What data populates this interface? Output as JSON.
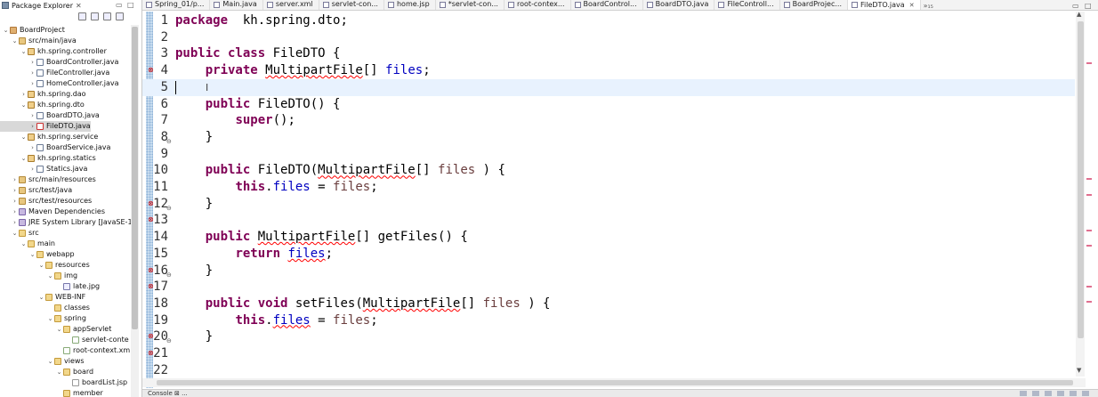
{
  "package_explorer": {
    "title": "Package Explorer",
    "tree": [
      {
        "label": "BoardProject",
        "depth": 0,
        "icon": "project",
        "twisty": "open"
      },
      {
        "label": "src/main/java",
        "depth": 1,
        "icon": "srcfolder",
        "twisty": "open"
      },
      {
        "label": "kh.spring.controller",
        "depth": 2,
        "icon": "package",
        "twisty": "open"
      },
      {
        "label": "BoardController.java",
        "depth": 3,
        "icon": "java",
        "twisty": "closed"
      },
      {
        "label": "FileController.java",
        "depth": 3,
        "icon": "java",
        "twisty": "closed"
      },
      {
        "label": "HomeController.java",
        "depth": 3,
        "icon": "java",
        "twisty": "closed"
      },
      {
        "label": "kh.spring.dao",
        "depth": 2,
        "icon": "package",
        "twisty": "closed"
      },
      {
        "label": "kh.spring.dto",
        "depth": 2,
        "icon": "package",
        "twisty": "open"
      },
      {
        "label": "BoardDTO.java",
        "depth": 3,
        "icon": "java",
        "twisty": "closed"
      },
      {
        "label": "FileDTO.java",
        "depth": 3,
        "icon": "javaerr",
        "twisty": "closed",
        "selected": true
      },
      {
        "label": "kh.spring.service",
        "depth": 2,
        "icon": "package",
        "twisty": "open"
      },
      {
        "label": "BoardService.java",
        "depth": 3,
        "icon": "java",
        "twisty": "closed"
      },
      {
        "label": "kh.spring.statics",
        "depth": 2,
        "icon": "package",
        "twisty": "open"
      },
      {
        "label": "Statics.java",
        "depth": 3,
        "icon": "java",
        "twisty": "closed"
      },
      {
        "label": "src/main/resources",
        "depth": 1,
        "icon": "srcfolder",
        "twisty": "closed"
      },
      {
        "label": "src/test/java",
        "depth": 1,
        "icon": "srcfolder",
        "twisty": "closed"
      },
      {
        "label": "src/test/resources",
        "depth": 1,
        "icon": "srcfolder",
        "twisty": "closed"
      },
      {
        "label": "Maven Dependencies",
        "depth": 1,
        "icon": "lib",
        "twisty": "closed"
      },
      {
        "label": "JRE System Library [JavaSE-1.8",
        "depth": 1,
        "icon": "lib",
        "twisty": "closed"
      },
      {
        "label": "src",
        "depth": 1,
        "icon": "folder",
        "twisty": "open"
      },
      {
        "label": "main",
        "depth": 2,
        "icon": "folder",
        "twisty": "open"
      },
      {
        "label": "webapp",
        "depth": 3,
        "icon": "folder",
        "twisty": "open"
      },
      {
        "label": "resources",
        "depth": 4,
        "icon": "folder",
        "twisty": "open"
      },
      {
        "label": "img",
        "depth": 5,
        "icon": "folder",
        "twisty": "open"
      },
      {
        "label": "late.jpg",
        "depth": 6,
        "icon": "img",
        "twisty": "none"
      },
      {
        "label": "WEB-INF",
        "depth": 4,
        "icon": "folder",
        "twisty": "open"
      },
      {
        "label": "classes",
        "depth": 5,
        "icon": "folder",
        "twisty": "none"
      },
      {
        "label": "spring",
        "depth": 5,
        "icon": "folder",
        "twisty": "open"
      },
      {
        "label": "appServlet",
        "depth": 6,
        "icon": "folder",
        "twisty": "open"
      },
      {
        "label": "servlet-conte",
        "depth": 7,
        "icon": "xml",
        "twisty": "none"
      },
      {
        "label": "root-context.xm",
        "depth": 6,
        "icon": "xml",
        "twisty": "none"
      },
      {
        "label": "views",
        "depth": 5,
        "icon": "folder",
        "twisty": "open"
      },
      {
        "label": "board",
        "depth": 6,
        "icon": "folder",
        "twisty": "open"
      },
      {
        "label": "boardList.jsp",
        "depth": 7,
        "icon": "file",
        "twisty": "none"
      },
      {
        "label": "member",
        "depth": 6,
        "icon": "folder",
        "twisty": "none"
      }
    ]
  },
  "editor_tabs": [
    {
      "label": "Spring_01/p..."
    },
    {
      "label": "Main.java"
    },
    {
      "label": "server.xml"
    },
    {
      "label": "servlet-con..."
    },
    {
      "label": "home.jsp"
    },
    {
      "label": "*servlet-con..."
    },
    {
      "label": "root-contex..."
    },
    {
      "label": "BoardControl..."
    },
    {
      "label": "BoardDTO.java"
    },
    {
      "label": "FileControll..."
    },
    {
      "label": "BoardProjec..."
    },
    {
      "label": "FileDTO.java",
      "active": true
    }
  ],
  "tabs_overflow": "»₁₅",
  "editor": {
    "current_line": 5,
    "lines": [
      {
        "n": "1",
        "tokens": [
          [
            "kw",
            "package"
          ],
          [
            "",
            "  kh.spring.dto;"
          ]
        ]
      },
      {
        "n": "2",
        "tokens": []
      },
      {
        "n": "3",
        "tokens": [
          [
            "kw",
            "public class"
          ],
          [
            "",
            " FileDTO {"
          ]
        ]
      },
      {
        "n": "4",
        "mark": true,
        "tokens": [
          [
            "",
            "    "
          ],
          [
            "kw",
            "private"
          ],
          [
            "",
            " "
          ],
          [
            "err",
            "MultipartFile"
          ],
          [
            "",
            "[] "
          ],
          [
            "fld",
            "files"
          ],
          [
            "",
            ";"
          ]
        ]
      },
      {
        "n": "5",
        "tokens": []
      },
      {
        "n": "6",
        "tokens": [
          [
            "",
            "    "
          ],
          [
            "kw",
            "public"
          ],
          [
            "",
            " FileDTO() {"
          ]
        ]
      },
      {
        "n": "7",
        "tokens": [
          [
            "",
            "        "
          ],
          [
            "kw",
            "super"
          ],
          [
            "",
            "();"
          ]
        ]
      },
      {
        "n": "8",
        "fold": true,
        "tokens": [
          [
            "",
            "    }"
          ]
        ]
      },
      {
        "n": "9",
        "tokens": []
      },
      {
        "n": "10",
        "tokens": [
          [
            "",
            "    "
          ],
          [
            "kw",
            "public"
          ],
          [
            "",
            " FileDTO("
          ],
          [
            "err",
            "MultipartFile"
          ],
          [
            "",
            "[] "
          ],
          [
            "prm",
            "files"
          ],
          [
            "",
            " ) {"
          ]
        ]
      },
      {
        "n": "11",
        "tokens": [
          [
            "",
            "        "
          ],
          [
            "kw",
            "this"
          ],
          [
            "",
            "."
          ],
          [
            "fld",
            "files"
          ],
          [
            "",
            " = "
          ],
          [
            "prm",
            "files"
          ],
          [
            "",
            ";"
          ]
        ]
      },
      {
        "n": "12",
        "mark": true,
        "fold": true,
        "tokens": [
          [
            "",
            "    }"
          ]
        ]
      },
      {
        "n": "13",
        "mark": true,
        "tokens": []
      },
      {
        "n": "14",
        "tokens": [
          [
            "",
            "    "
          ],
          [
            "kw",
            "public"
          ],
          [
            "",
            " "
          ],
          [
            "err",
            "MultipartFile"
          ],
          [
            "",
            "[] getFiles() {"
          ]
        ]
      },
      {
        "n": "15",
        "tokens": [
          [
            "",
            "        "
          ],
          [
            "kw",
            "return"
          ],
          [
            "",
            " "
          ],
          [
            "fld err",
            "files"
          ],
          [
            "",
            ";"
          ]
        ]
      },
      {
        "n": "16",
        "mark": true,
        "fold": true,
        "tokens": [
          [
            "",
            "    }"
          ]
        ]
      },
      {
        "n": "17",
        "mark": true,
        "tokens": []
      },
      {
        "n": "18",
        "tokens": [
          [
            "",
            "    "
          ],
          [
            "kw",
            "public void"
          ],
          [
            "",
            " setFiles("
          ],
          [
            "err",
            "MultipartFile"
          ],
          [
            "",
            "[] "
          ],
          [
            "prm",
            "files"
          ],
          [
            "",
            " ) {"
          ]
        ]
      },
      {
        "n": "19",
        "tokens": [
          [
            "",
            "        "
          ],
          [
            "kw",
            "this"
          ],
          [
            "",
            "."
          ],
          [
            "fld err",
            "files"
          ],
          [
            "",
            " = "
          ],
          [
            "prm",
            "files"
          ],
          [
            "",
            ";"
          ]
        ]
      },
      {
        "n": "20",
        "mark": true,
        "fold": true,
        "tokens": [
          [
            "",
            "    }"
          ]
        ]
      },
      {
        "n": "21",
        "mark": true,
        "tokens": []
      },
      {
        "n": "22",
        "tokens": []
      }
    ]
  },
  "colors": {
    "keyword": "#7f0055",
    "field": "#0000c0",
    "parameter": "#6a3e3e",
    "current_line": "#e8f2fe",
    "error_underline": "#ff0000",
    "ruler_mark": "#e07090"
  },
  "bottom": {
    "label": "Console ⊠ ..."
  }
}
